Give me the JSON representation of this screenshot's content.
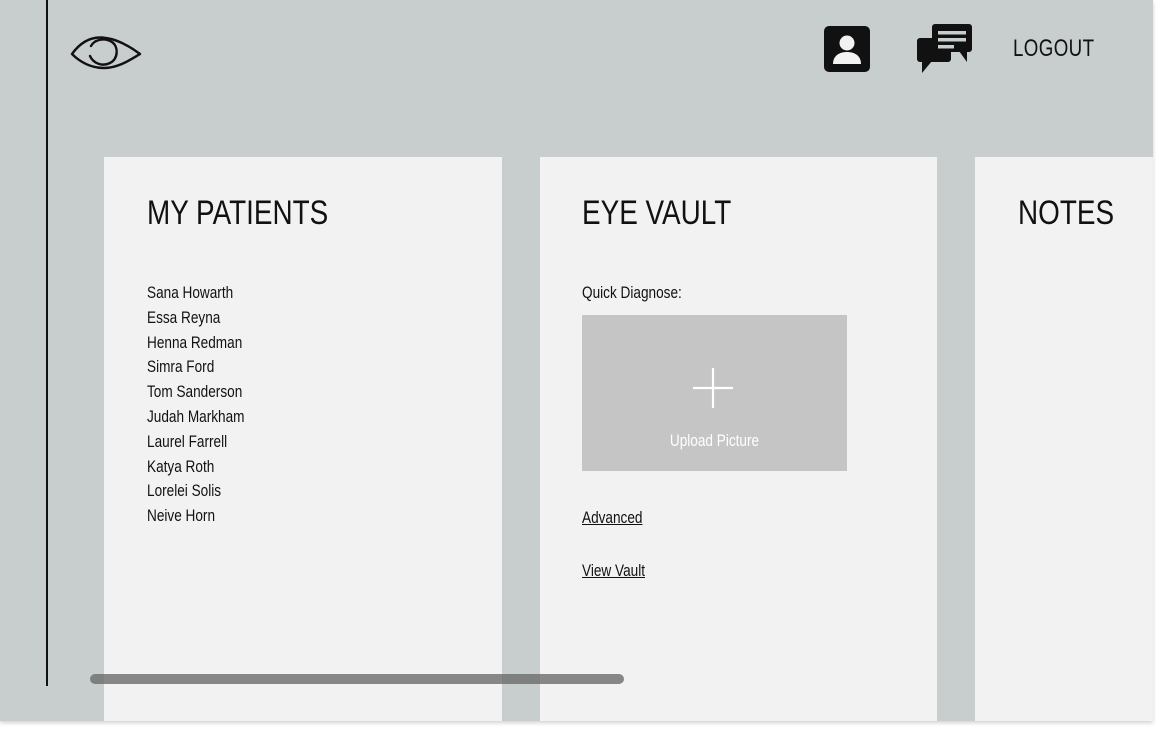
{
  "header": {
    "logo_icon": "eye-icon",
    "profile_icon": "user-profile-icon",
    "messages_icon": "chat-bubbles-icon",
    "logout_label": "LOGOUT"
  },
  "patients": {
    "title": "MY PATIENTS",
    "items": [
      "Sana Howarth",
      "Essa Reyna",
      "Henna Redman",
      "Simra Ford",
      "Tom Sanderson",
      "Judah Markham",
      "Laurel Farrell",
      "Katya Roth",
      "Lorelei Solis",
      "Neive Horn"
    ]
  },
  "vault": {
    "title": "EYE VAULT",
    "quick_label": "Quick Diagnose:",
    "upload_icon": "plus-icon",
    "upload_label": "Upload Picture",
    "advanced_link": "Advanced",
    "view_vault_link": "View Vault"
  },
  "notes": {
    "title": "NOTES"
  },
  "colors": {
    "background": "#c8cdce",
    "card": "#f2f2f2",
    "upload_box": "#c5c5c5",
    "text": "#111111",
    "scrollbar": "#6b6b6b"
  }
}
